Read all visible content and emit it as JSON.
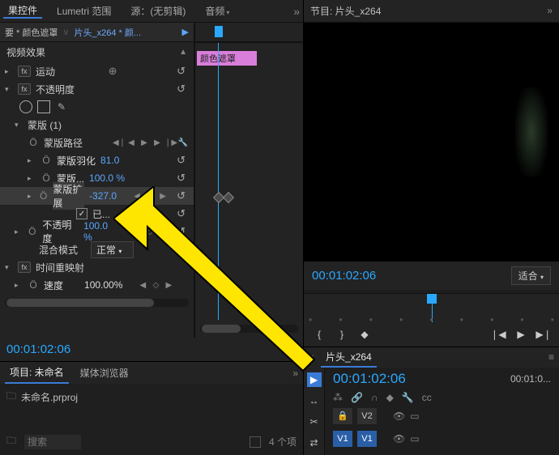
{
  "left_tabs": {
    "effect_controls": "果控件",
    "lumetri": "Lumetri 范围",
    "source_label": "源：(无剪辑)",
    "audio_short": "音频"
  },
  "crumb": {
    "root": "要 * 颜色遮罩",
    "clip": "片头_x264 * 颜..."
  },
  "mini_clip_label": "颜色遮罩",
  "effects": {
    "header": "视频效果",
    "motion": "运动",
    "opacity": "不透明度",
    "mask_group": "蒙版 (1)",
    "mask_path": "蒙版路径",
    "mask_feather": {
      "label": "蒙版羽化",
      "value": "81.0"
    },
    "mask_opacity": {
      "label": "蒙版...",
      "value": "100.0 %"
    },
    "mask_expansion": {
      "label": "蒙版扩展",
      "value": "-327.0"
    },
    "inverted_checkbox": {
      "label": "已...",
      "checked": true
    },
    "opacity2": {
      "label": "不透明度",
      "value": "100.0 %"
    },
    "blend_mode": {
      "label": "混合模式",
      "value": "正常"
    },
    "time_remap": "时间重映射",
    "speed": {
      "label": "速度",
      "value": "100.00%"
    }
  },
  "tc_left_bottom": "00:01:02:06",
  "project": {
    "tab_project": "项目: 未命名",
    "tab_media": "媒体浏览器",
    "file": "未命名.prproj",
    "search_placeholder": "搜索",
    "item_count": "4 个项"
  },
  "program": {
    "tab_label": "节目: 片头_x264",
    "timecode": "00:01:02:06",
    "fit_label": "适合"
  },
  "sequence": {
    "tab_label": "片头_x264",
    "timecode": "00:01:02:06",
    "end_tc": "00:01:0...",
    "tracks": {
      "v2": "V2",
      "v1": "V1"
    }
  },
  "icons": {
    "fx": "fx",
    "reset": "↺",
    "target": "⊕",
    "wrench": "🔧",
    "prev": "◀",
    "next": "▶",
    "diamond": "◆",
    "play": "▶",
    "step_back": "❘◀",
    "step_fwd": "▶❘",
    "in": "{",
    "out": "}",
    "snap": "🧲",
    "link": "🔗",
    "marker": "◆",
    "wrench2": "🔧",
    "cc": "cc",
    "razor": "✂",
    "arrow": "↕",
    "lock": "🔒"
  }
}
